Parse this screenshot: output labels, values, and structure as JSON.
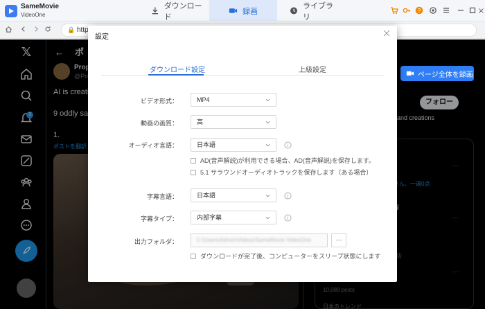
{
  "app": {
    "name": "SameMovie",
    "subtitle": "VideoOne",
    "tabs": [
      {
        "label": "ダウンロード",
        "icon": "download-icon",
        "active": false
      },
      {
        "label": "録画",
        "icon": "record-icon",
        "active": true
      },
      {
        "label": "ライブラリ",
        "icon": "clock-icon",
        "active": false
      }
    ],
    "accent_color": "#2a6fd6"
  },
  "addressbar": {
    "url": "http"
  },
  "twitter": {
    "header_back": "←",
    "header_title": "ポ",
    "tweet_name": "Prop",
    "tweet_handle": "@Pro",
    "tweet_text_1": "AI is creatin",
    "tweet_text_2": "9 oddly sat",
    "tweet_text_3": "1.",
    "translate_link": "ポストを翻訳",
    "notification_count": "3",
    "follow_button": "フォロー",
    "side_text": "and creations",
    "side_link": "さん、一週0点",
    "side_text_2": "曜",
    "side_tiny": "店",
    "posts_count": "10,089 posts",
    "trend_text": "日本のトレンド",
    "side_dots": "···"
  },
  "record_button": {
    "label": "ページ全体を録画"
  },
  "dialog": {
    "title": "設定",
    "tabs": {
      "download": "ダウンロード設定",
      "advanced": "上級設定"
    },
    "fields": {
      "video_format": {
        "label": "ビデオ形式：",
        "value": "MP4"
      },
      "video_quality": {
        "label": "動画の画質：",
        "value": "高"
      },
      "audio_language": {
        "label": "オーディオ言語：",
        "value": "日本語"
      },
      "subtitle_language": {
        "label": "字幕言語：",
        "value": "日本語"
      },
      "subtitle_type": {
        "label": "字幕タイプ：",
        "value": "内部字幕"
      },
      "output_folder": {
        "label": "出力フォルダ：",
        "value": "C:\\Users\\Admin\\Videos\\SameMovie VideoOne",
        "browse": "···"
      }
    },
    "checkboxes": {
      "ad_audio": "AD(音声解説)が利用できる場合、AD(音声解説)を保存します。",
      "surround": "5.1 サラウンドオーディオトラックを保存します（ある場合）",
      "sleep": "ダウンロードが完了後、コンピューターをスリープ状態にします"
    }
  }
}
